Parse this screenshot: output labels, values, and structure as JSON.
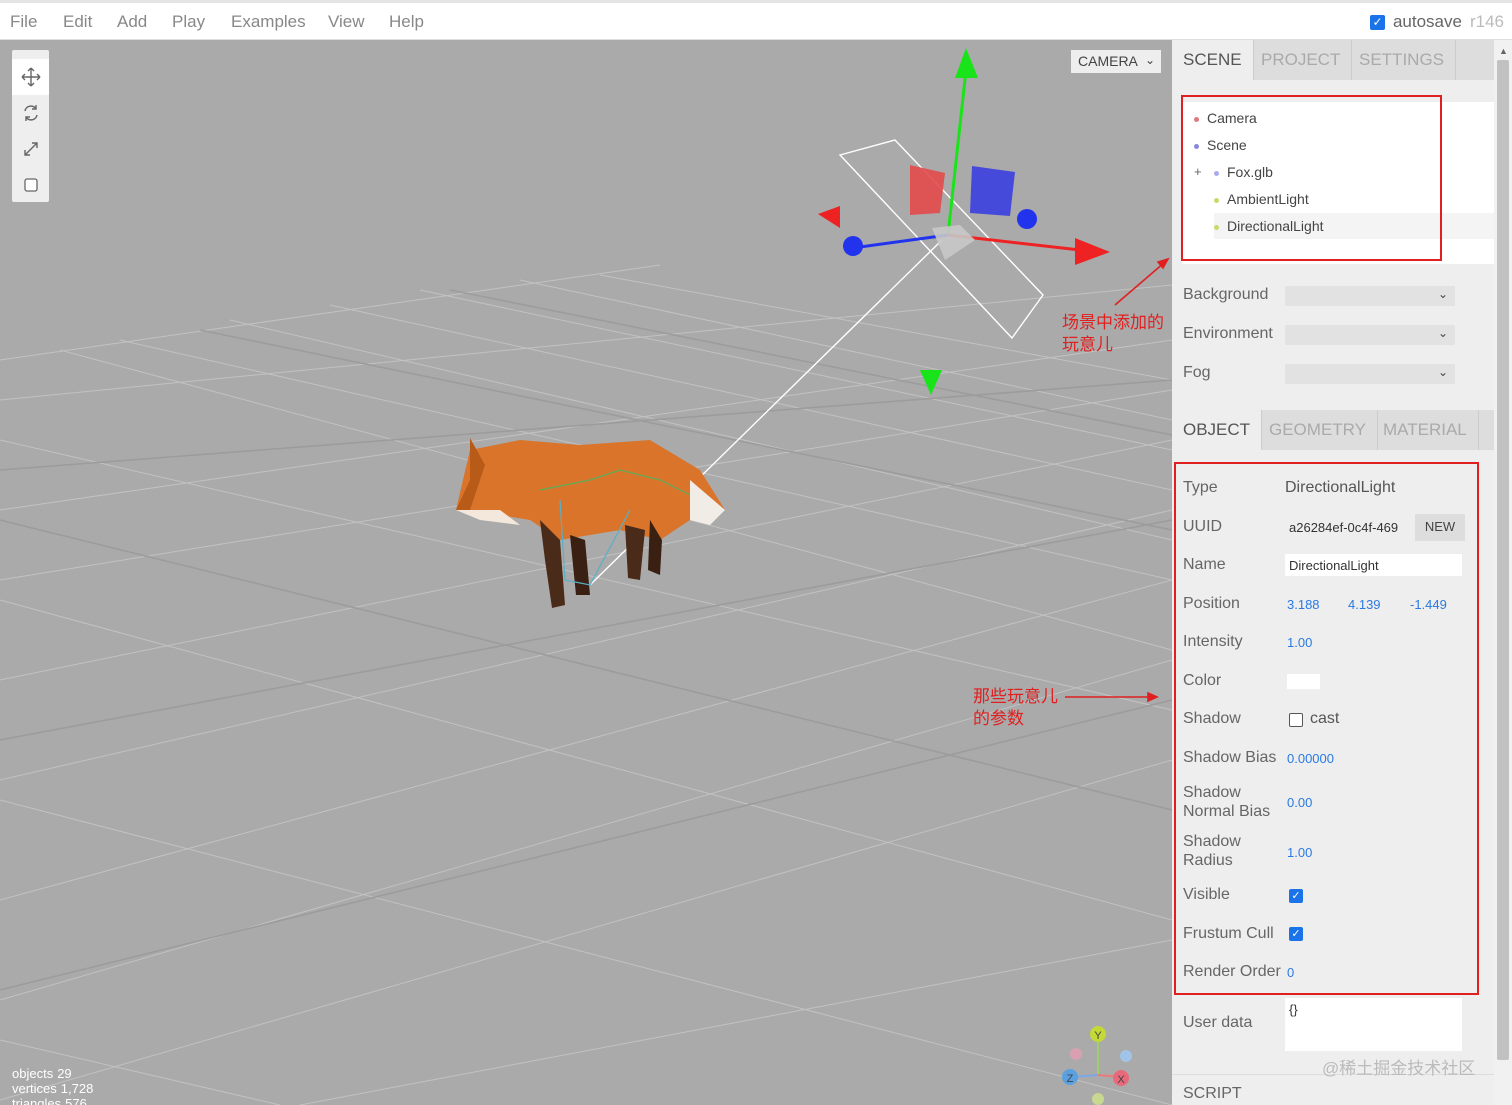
{
  "menubar": {
    "items": [
      "File",
      "Edit",
      "Add",
      "Play",
      "Examples",
      "View",
      "Help"
    ],
    "autosave_label": "autosave",
    "autosave_checked": true,
    "version": "r146"
  },
  "viewport": {
    "camera_select": "CAMERA",
    "annotation_top": [
      "场景中添加的",
      "玩意儿"
    ],
    "annotation_bottom": [
      "那些玩意儿",
      "的参数"
    ],
    "info": {
      "objects_label": "objects",
      "objects_value": "29",
      "vertices_label": "vertices",
      "vertices_value": "1,728",
      "triangles_label": "triangles",
      "triangles_value": "576"
    },
    "helper_axes": {
      "y_label": "Y",
      "z_label": "Z",
      "x_label": "X"
    }
  },
  "sidebar": {
    "tabs": [
      "SCENE",
      "PROJECT",
      "SETTINGS"
    ],
    "outliner": [
      {
        "label": "Camera",
        "color": "#e07a7a"
      },
      {
        "label": "Scene",
        "color": "#8888dd"
      },
      {
        "label": "Fox.glb",
        "color": "#aaaaee",
        "opener": "+"
      },
      {
        "label": "AmbientLight",
        "color": "#c8d86a"
      },
      {
        "label": "DirectionalLight",
        "color": "#c8d86a"
      }
    ],
    "scene_props": [
      {
        "label": "Background"
      },
      {
        "label": "Environment"
      },
      {
        "label": "Fog"
      }
    ],
    "object_tabs": [
      "OBJECT",
      "GEOMETRY",
      "MATERIAL"
    ],
    "object": {
      "type_label": "Type",
      "type_value": "DirectionalLight",
      "uuid_label": "UUID",
      "uuid_value": "a26284ef-0c4f-469",
      "uuid_button": "NEW",
      "name_label": "Name",
      "name_value": "DirectionalLight",
      "position_label": "Position",
      "position": [
        "3.188",
        "4.139",
        "-1.449"
      ],
      "intensity_label": "Intensity",
      "intensity": "1.00",
      "color_label": "Color",
      "color_value": "#ffffff",
      "shadow_label": "Shadow",
      "shadow_cast_label": "cast",
      "shadow_bias_label": "Shadow Bias",
      "shadow_bias": "0.00000",
      "shadow_normal_bias_label_1": "Shadow",
      "shadow_normal_bias_label_2": "Normal Bias",
      "shadow_normal_bias": "0.00",
      "shadow_radius_label_1": "Shadow",
      "shadow_radius_label_2": "Radius",
      "shadow_radius": "1.00",
      "visible_label": "Visible",
      "frustum_cull_label": "Frustum Cull",
      "render_order_label": "Render Order",
      "render_order": "0",
      "user_data_label": "User data",
      "user_data": "{}"
    },
    "script_label": "SCRIPT"
  },
  "watermark": "@稀土掘金技术社区"
}
